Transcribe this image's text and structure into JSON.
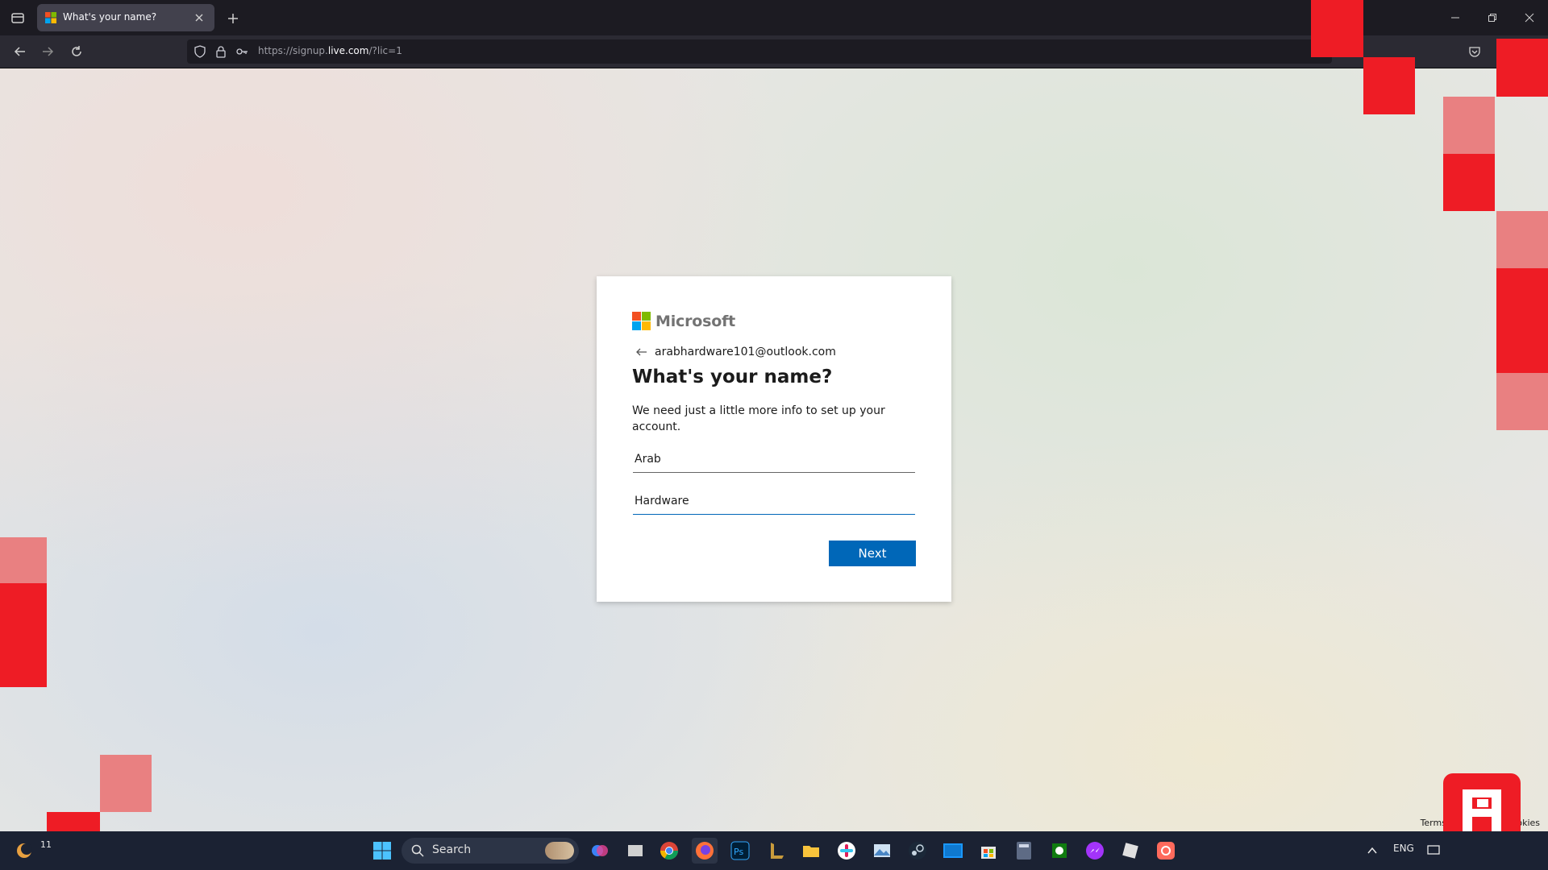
{
  "browser": {
    "tab_title": "What's your name?",
    "url_prefix": "https://signup.",
    "url_domain": "live.com",
    "url_suffix": "/?lic=1"
  },
  "card": {
    "brand": "Microsoft",
    "identity_email": "arabhardware101@outlook.com",
    "heading": "What's your name?",
    "description": "We need just a little more info to set up your account.",
    "first_name_value": "Arab",
    "last_name_value": "Hardware",
    "next_label": "Next",
    "logo_colors": [
      "#f25022",
      "#7fba00",
      "#00a4ef",
      "#ffb900"
    ]
  },
  "footer": {
    "terms": "Terms of Us",
    "cookies": "okies"
  },
  "taskbar": {
    "search_label": "Search",
    "language": "ENG",
    "clock_fragment": "11"
  },
  "icons": {
    "tab_list": "tab-list-icon",
    "back": "arrow-left-icon",
    "forward": "arrow-right-icon",
    "reload": "reload-icon",
    "shield": "shield-icon",
    "lock": "lock-icon",
    "key": "key-icon"
  },
  "colors": {
    "accent": "#0067b8",
    "overlay_red": "#ee1c25",
    "overlay_pink": "#e98081"
  }
}
